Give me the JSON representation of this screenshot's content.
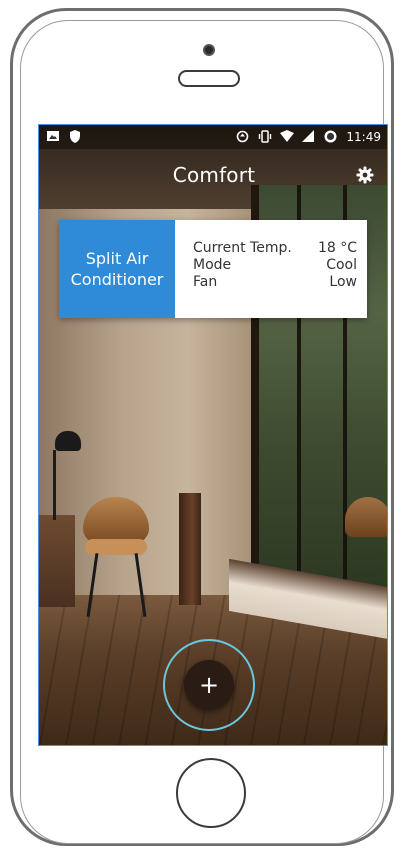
{
  "status_bar": {
    "time": "11:49",
    "left_icons": [
      "image-icon",
      "shield-icon"
    ],
    "right_icons": [
      "sync-icon",
      "vibrate-icon",
      "wifi-icon",
      "signal-icon",
      "alarm-icon"
    ]
  },
  "app_bar": {
    "title": "Comfort",
    "settings_icon": "gear-icon"
  },
  "device_card": {
    "name": "Split Air\nConditioner",
    "accent_color": "#2f8ad8",
    "rows": [
      {
        "label": "Current Temp.",
        "value": "18 °C"
      },
      {
        "label": "Mode",
        "value": "Cool"
      },
      {
        "label": "Fan",
        "value": "Low"
      }
    ]
  },
  "fab": {
    "label": "+",
    "ring_color": "#6cc6dc"
  }
}
